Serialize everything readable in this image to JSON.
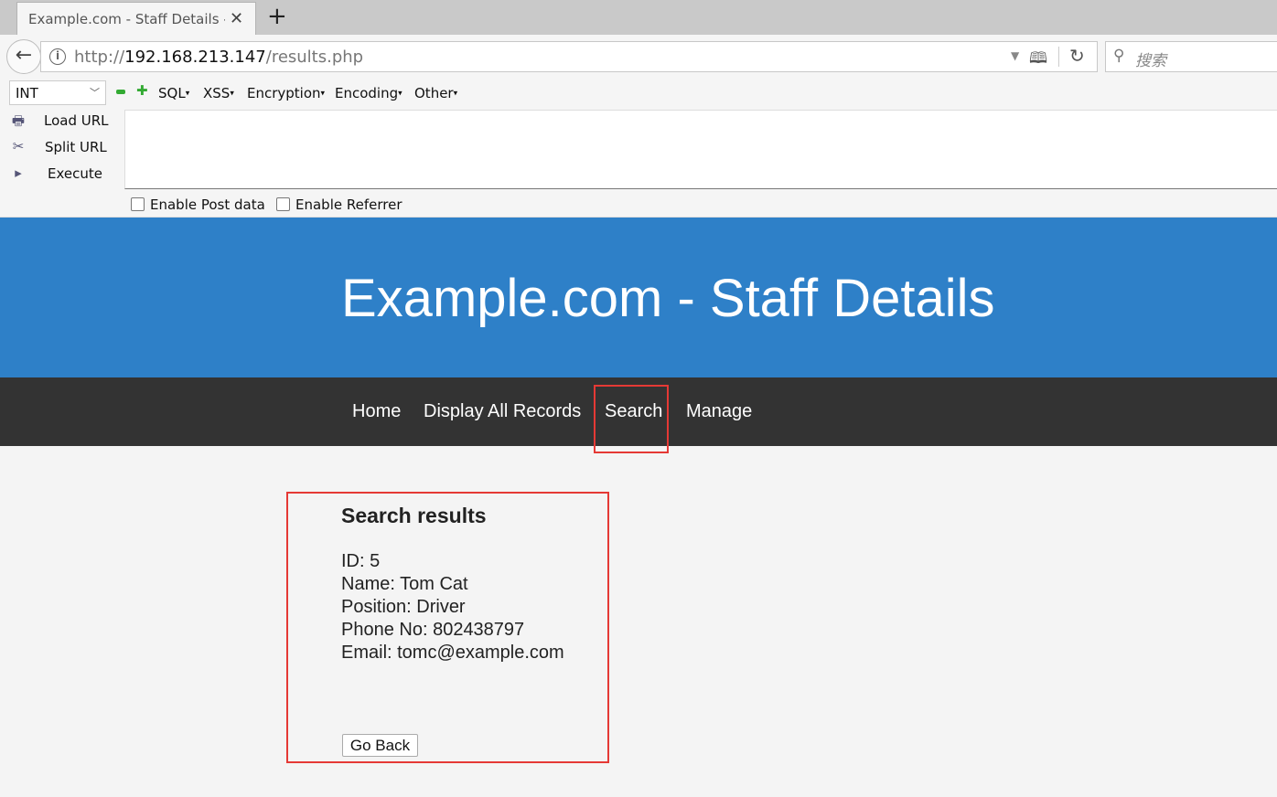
{
  "browser": {
    "tab_title": "Example.com - Staff Details - ",
    "new_tab_glyph": "+",
    "url_scheme": "http://",
    "url_host": "192.168.213.147",
    "url_path": "/results.php",
    "search_placeholder": "搜索"
  },
  "hackbar": {
    "encoding_select": "INT",
    "menus": [
      "SQL",
      "XSS",
      "Encryption",
      "Encoding",
      "Other"
    ],
    "load_url": "Load URL",
    "split_url": "Split URL",
    "execute": "Execute",
    "enable_post": "Enable Post data",
    "enable_referrer": "Enable Referrer"
  },
  "page": {
    "title": "Example.com - Staff Details",
    "nav": [
      "Home",
      "Display All Records",
      "Search",
      "Manage"
    ],
    "results_heading": "Search results",
    "result": {
      "id": "ID: 5",
      "name": "Name: Tom Cat",
      "position": "Position: Driver",
      "phone": "Phone No: 802438797",
      "email": "Email: tomc@example.com"
    },
    "go_back": "Go Back"
  },
  "colors": {
    "hero_bg": "#2e80c8",
    "nav_bg": "#333333",
    "highlight": "#e53935"
  }
}
